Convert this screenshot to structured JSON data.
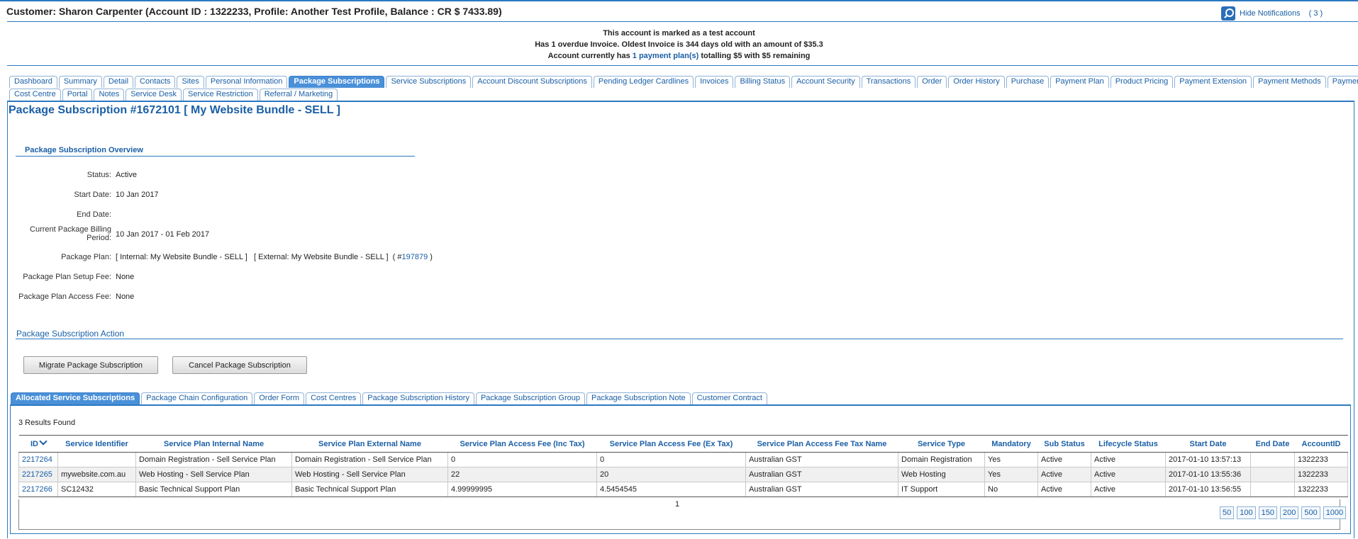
{
  "header": {
    "customer_title": "Customer: Sharon Carpenter (Account ID : 1322233, Profile: Another Test Profile, Balance : CR $ 7433.89)",
    "notifications_label": "Hide Notifications",
    "notifications_count": "( 3 )"
  },
  "notices": {
    "line1": "This account is marked as a test account",
    "line2": "Has 1 overdue Invoice. Oldest Invoice is 344 days old with an amount of $35.3",
    "line3_prefix": "Account currently has",
    "line3_link": "1 payment plan(s)",
    "line3_suffix": "totalling $5 with $5 remaining"
  },
  "tabs_row1": [
    "Dashboard",
    "Summary",
    "Detail",
    "Contacts",
    "Sites",
    "Personal Information",
    "Package Subscriptions",
    "Service Subscriptions",
    "Account Discount Subscriptions",
    "Pending Ledger Cardlines",
    "Invoices",
    "Billing Status",
    "Account Security",
    "Transactions",
    "Order",
    "Order History",
    "Purchase",
    "Payment Plan",
    "Product Pricing",
    "Payment Extension",
    "Payment Methods",
    "Payments"
  ],
  "tabs_row2": [
    "Cost Centre",
    "Portal",
    "Notes",
    "Service Desk",
    "Service Restriction",
    "Referral / Marketing"
  ],
  "active_tab": "Package Subscriptions",
  "page_title": "Package Subscription #1672101 [ My Website Bundle - SELL ]",
  "overview": {
    "section_title": "Package Subscription Overview",
    "status_label": "Status:",
    "status_value": "Active",
    "start_label": "Start Date:",
    "start_value": "10 Jan 2017",
    "end_label": "End Date:",
    "end_value": "",
    "billing_label_1": "Current Package Billing",
    "billing_label_2": "Period:",
    "billing_value": "10 Jan 2017 - 01 Feb 2017",
    "plan_label": "Package Plan:",
    "plan_value_text": "[ Internal: My Website Bundle - SELL ]   [ External: My Website Bundle - SELL ]  ( #",
    "plan_value_link": "197879",
    "plan_value_suffix": " )",
    "setup_label": "Package Plan Setup Fee:",
    "setup_value": "None",
    "access_label": "Package Plan Access Fee:",
    "access_value": "None"
  },
  "action": {
    "section_title": "Package Subscription Action",
    "migrate_button": "Migrate Package Subscription",
    "cancel_button": "Cancel Package Subscription"
  },
  "sub_tabs": [
    "Allocated Service Subscriptions",
    "Package Chain Configuration",
    "Order Form",
    "Cost Centres",
    "Package Subscription History",
    "Package Subscription Group",
    "Package Subscription Note",
    "Customer Contract"
  ],
  "active_sub_tab": "Allocated Service Subscriptions",
  "results_text": "3 Results Found",
  "table": {
    "columns": [
      "ID",
      "Service Identifier",
      "Service Plan Internal Name",
      "Service Plan External Name",
      "Service Plan Access Fee (Inc Tax)",
      "Service Plan Access Fee (Ex Tax)",
      "Service Plan Access Fee Tax Name",
      "Service Type",
      "Mandatory",
      "Sub Status",
      "Lifecycle Status",
      "Start Date",
      "End Date",
      "AccountID"
    ],
    "rows": [
      [
        "2217264",
        "",
        "Domain Registration - Sell Service Plan",
        "Domain Registration - Sell Service Plan",
        "0",
        "0",
        "Australian GST",
        "Domain Registration",
        "Yes",
        "Active",
        "Active",
        "2017-01-10 13:57:13",
        "",
        "1322233"
      ],
      [
        "2217265",
        "mywebsite.com.au",
        "Web Hosting - Sell Service Plan",
        "Web Hosting - Sell Service Plan",
        "22",
        "20",
        "Australian GST",
        "Web Hosting",
        "Yes",
        "Active",
        "Active",
        "2017-01-10 13:55:36",
        "",
        "1322233"
      ],
      [
        "2217266",
        "SC12432",
        "Basic Technical Support Plan",
        "Basic Technical Support Plan",
        "4.99999995",
        "4.5454545",
        "Australian GST",
        "IT Support",
        "No",
        "Active",
        "Active",
        "2017-01-10 13:56:55",
        "",
        "1322233"
      ]
    ]
  },
  "pager": {
    "current_page": "1",
    "page_sizes": [
      "50",
      "100",
      "150",
      "200",
      "500",
      "1000"
    ]
  },
  "colors": {
    "accent": "#2c79c1",
    "link": "#1a5fa6",
    "active_tab": "#4a90d9"
  }
}
